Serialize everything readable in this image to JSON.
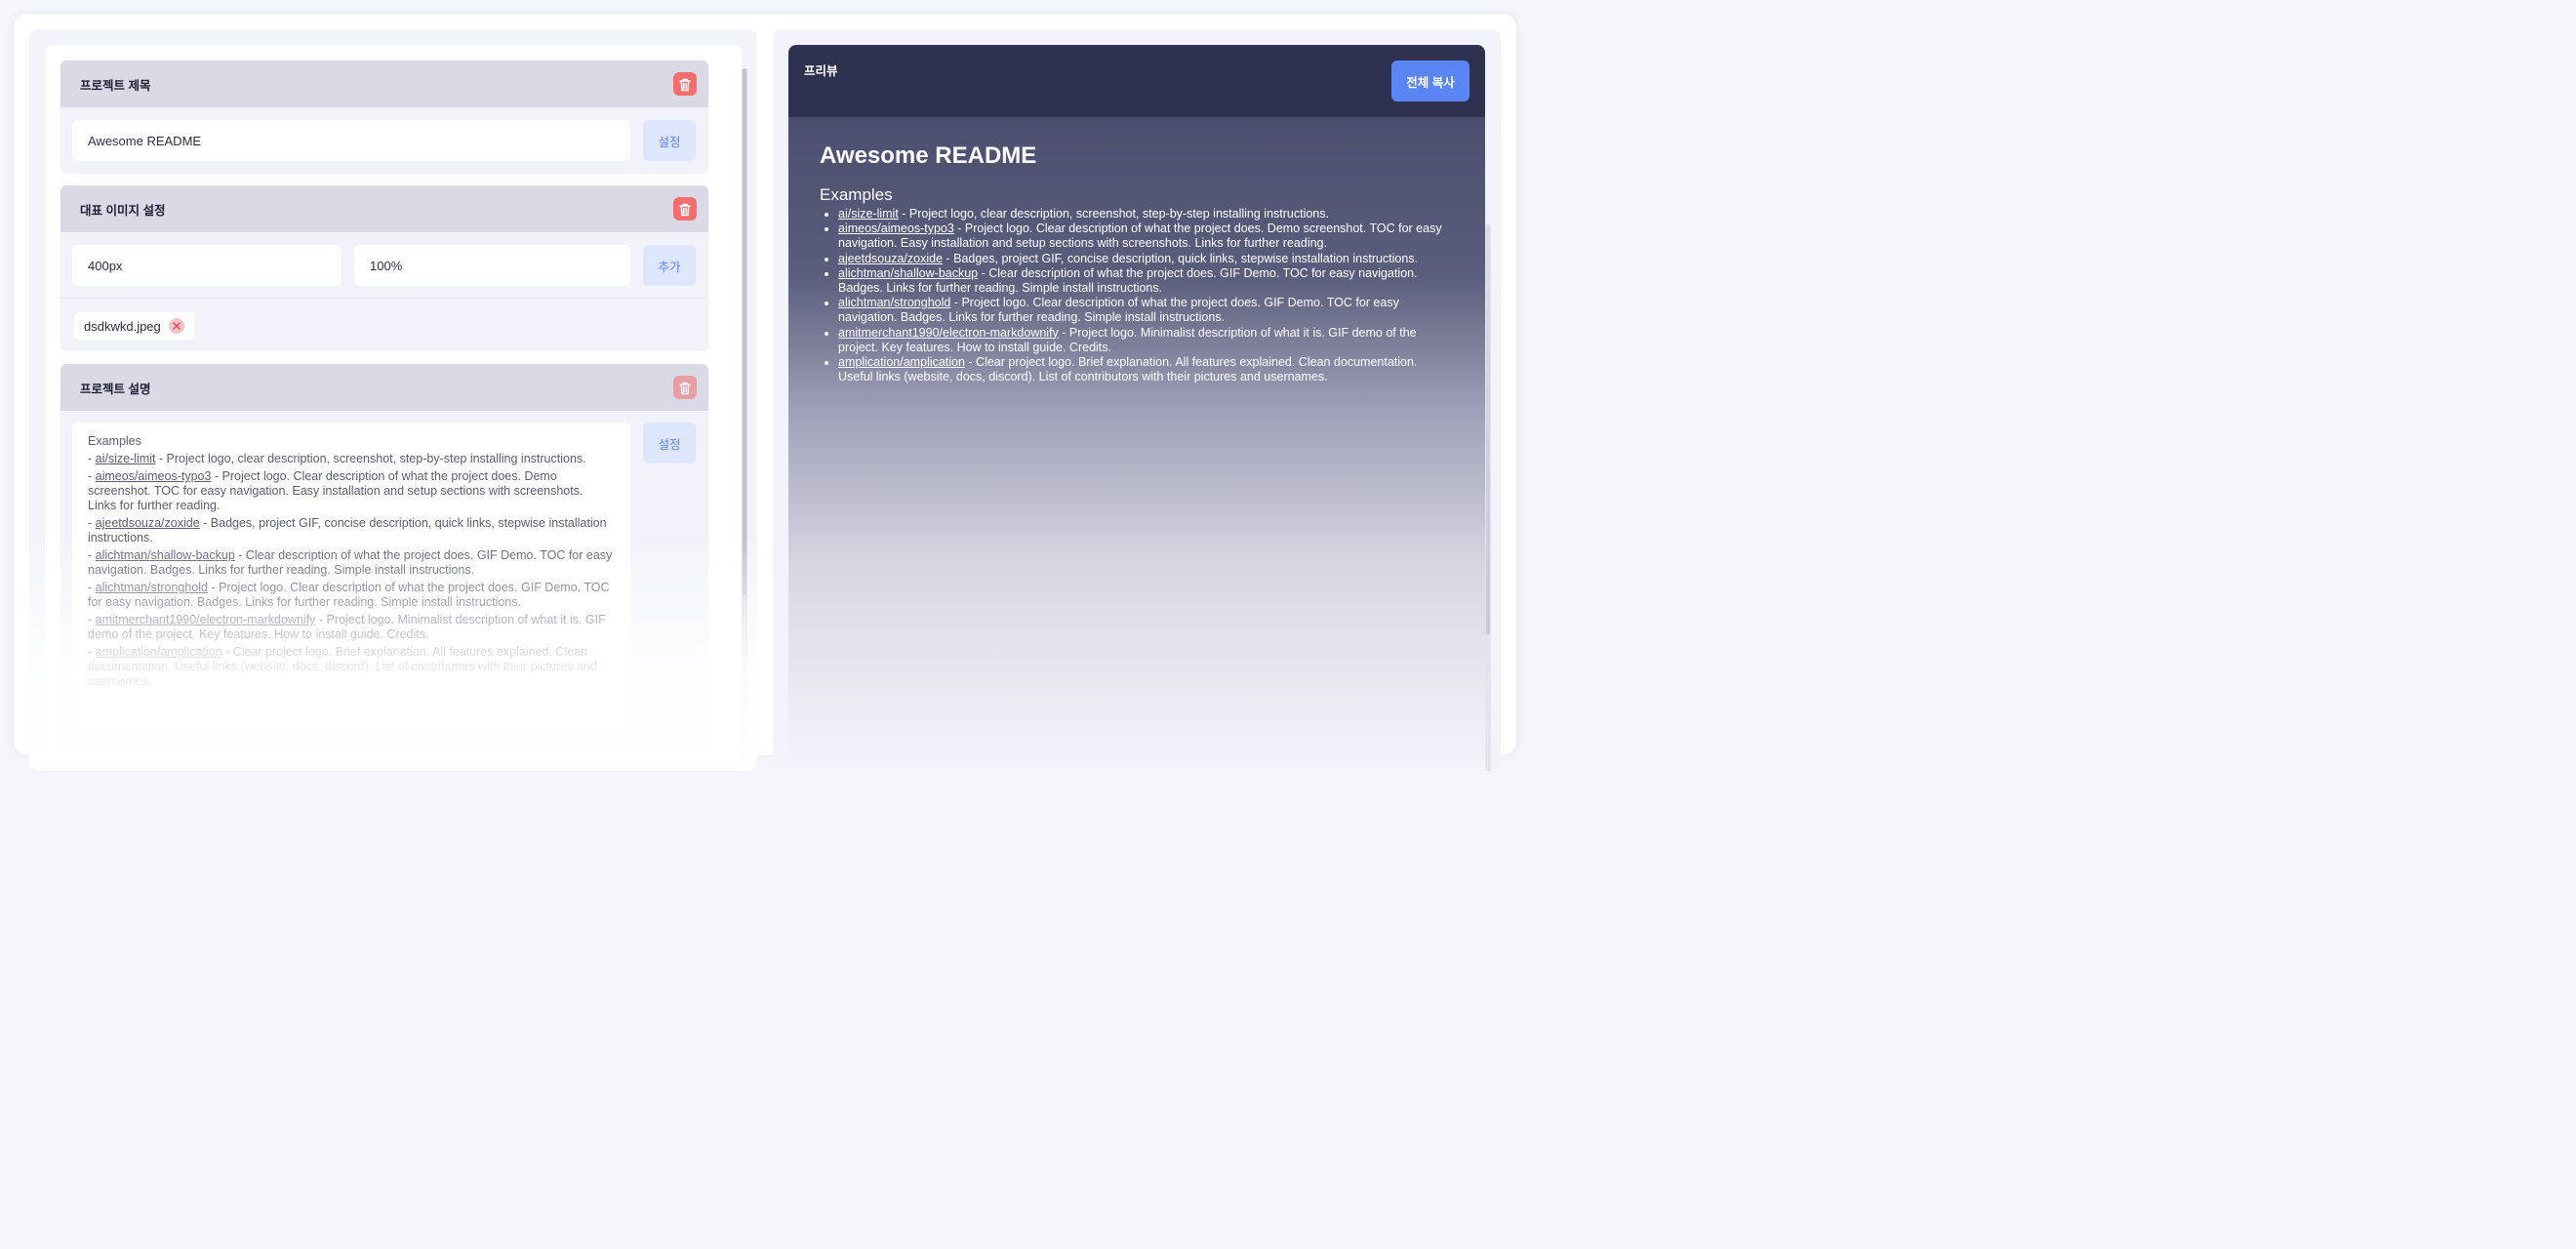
{
  "editor": {
    "sections": {
      "project_title": {
        "title": "프로젝트 제목",
        "value": "Awesome README",
        "button": "설정"
      },
      "image_settings": {
        "title": "대표 이미지 설정",
        "width_value": "400px",
        "percent_value": "100%",
        "button": "추가",
        "file_chip": "dsdkwkd.jpeg"
      },
      "project_description": {
        "title": "프로젝트 설명",
        "button": "설정",
        "heading": "Examples",
        "items": [
          {
            "link": "ai/size-limit",
            "text": " - Project logo, clear description, screenshot, step-by-step installing instructions."
          },
          {
            "link": "aimeos/aimeos-typo3",
            "text": " - Project logo. Clear description of what the project does. Demo screenshot. TOC for easy navigation. Easy installation and setup sections with screenshots. Links for further reading."
          },
          {
            "link": "ajeetdsouza/zoxide",
            "text": " - Badges, project GIF, concise description, quick links, stepwise installation instructions."
          },
          {
            "link": "alichtman/shallow-backup",
            "text": " - Clear description of what the project does. GIF Demo. TOC for easy navigation. Badges. Links for further reading. Simple install instructions."
          },
          {
            "link": "alichtman/stronghold",
            "text": " - Project logo. Clear description of what the project does. GIF Demo. TOC for easy navigation. Badges. Links for further reading. Simple install instructions."
          },
          {
            "link": "amitmerchant1990/electron-markdownify",
            "text": " - Project logo. Minimalist description of what it is. GIF demo of the project. Key features. How to install guide. Credits."
          },
          {
            "link": "amplication/amplication",
            "text": " - Clear project logo. Brief explanation. All features explained. Clean documentation. Useful links (website, docs, discord). List of contributors with their pictures and usernames."
          }
        ]
      }
    },
    "colors": {
      "trash": "#f56e6e",
      "accent": "#5a86f5",
      "header_dark": "#2e3150"
    }
  },
  "preview": {
    "label": "프리뷰",
    "copy_button": "전체 복사",
    "title": "Awesome README",
    "heading": "Examples",
    "items": [
      {
        "link": "ai/size-limit",
        "text": " - Project logo, clear description, screenshot, step-by-step installing instructions."
      },
      {
        "link": "aimeos/aimeos-typo3",
        "text": " - Project logo. Clear description of what the project does. Demo screenshot. TOC for easy navigation. Easy installation and setup sections with screenshots. Links for further reading."
      },
      {
        "link": "ajeetdsouza/zoxide",
        "text": " - Badges, project GIF, concise description, quick links, stepwise installation instructions."
      },
      {
        "link": "alichtman/shallow-backup",
        "text": " - Clear description of what the project does. GIF Demo. TOC for easy navigation. Badges. Links for further reading. Simple install instructions."
      },
      {
        "link": "alichtman/stronghold",
        "text": " - Project logo. Clear description of what the project does. GIF Demo. TOC for easy navigation. Badges. Links for further reading. Simple install instructions."
      },
      {
        "link": "amitmerchant1990/electron-markdownify",
        "text": " - Project logo. Minimalist description of what it is. GIF demo of the project. Key features. How to install guide. Credits."
      },
      {
        "link": "amplication/amplication",
        "text": " - Clear project logo. Brief explanation. All features explained. Clean documentation. Useful links (website, docs, discord). List of contributors with their pictures and usernames."
      }
    ]
  }
}
